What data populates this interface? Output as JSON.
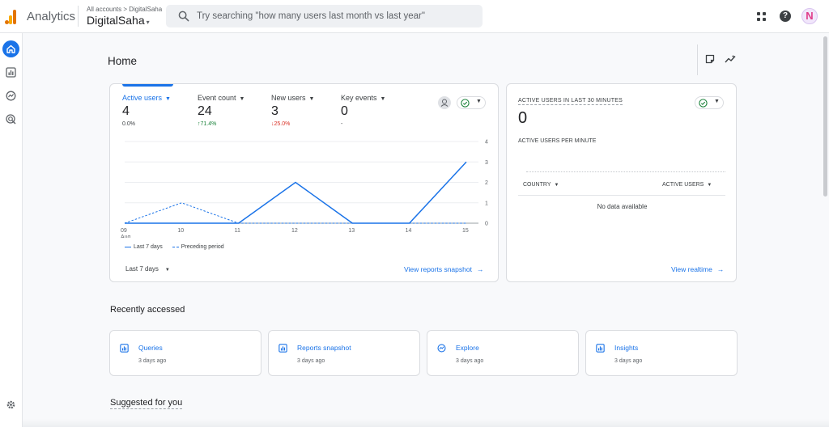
{
  "header": {
    "app_name": "Analytics",
    "breadcrumb": "All accounts > DigitalSaha",
    "account_name": "DigitalSaha",
    "search_placeholder": "Try searching \"how many users last month vs last year\"",
    "avatar_letter": "N",
    "icons": [
      "analytics-logo",
      "search-icon",
      "apps-grid-icon",
      "help-icon",
      "avatar"
    ]
  },
  "leftnav": {
    "items": [
      {
        "name": "home",
        "icon": "home-icon",
        "active": true
      },
      {
        "name": "reports",
        "icon": "bar-chart-icon"
      },
      {
        "name": "explore",
        "icon": "explore-icon"
      },
      {
        "name": "advertising",
        "icon": "target-icon"
      }
    ],
    "settings_icon": "gear-icon"
  },
  "page": {
    "title": "Home"
  },
  "metrics": [
    {
      "label": "Active users",
      "value": "4",
      "change": "0.0%",
      "trend": "neutral",
      "active": true
    },
    {
      "label": "Event count",
      "value": "24",
      "change": "↑71.4%",
      "trend": "up"
    },
    {
      "label": "New users",
      "value": "3",
      "change": "↓25.0%",
      "trend": "down"
    },
    {
      "label": "Key events",
      "value": "0",
      "change": "-",
      "trend": "neutral"
    }
  ],
  "chart_data": {
    "type": "line",
    "categories": [
      "09 Aug",
      "10",
      "11",
      "12",
      "13",
      "14",
      "15"
    ],
    "x_tick_labels": [
      [
        "09",
        "Aug"
      ],
      [
        "10"
      ],
      [
        "11"
      ],
      [
        "12"
      ],
      [
        "13"
      ],
      [
        "14"
      ],
      [
        "15"
      ]
    ],
    "series": [
      {
        "name": "Last 7 days",
        "style": "solid",
        "values": [
          0,
          0,
          0,
          2,
          0,
          0,
          3
        ]
      },
      {
        "name": "Preceding period",
        "style": "dashed",
        "values": [
          0,
          1,
          0,
          0,
          0,
          0,
          0
        ]
      }
    ],
    "ylim": [
      0,
      4
    ],
    "y_ticks": [
      0,
      1,
      2,
      3,
      4
    ],
    "y_axis_side": "right",
    "grid": true,
    "legend": "bottom-left",
    "color": "#1a73e8"
  },
  "metrics_card": {
    "range_label": "Last 7 days",
    "link_label": "View reports snapshot",
    "link_arrow": "→"
  },
  "realtime": {
    "title": "ACTIVE USERS IN LAST 30 MINUTES",
    "value": "0",
    "subtitle": "ACTIVE USERS PER MINUTE",
    "col_country": "COUNTRY",
    "col_active_users": "ACTIVE USERS",
    "empty_text": "No data available",
    "link_label": "View realtime",
    "link_arrow": "→"
  },
  "recently_accessed": {
    "title": "Recently accessed",
    "items": [
      {
        "title": "Queries",
        "time": "3 days ago",
        "icon": "bar-chart-icon"
      },
      {
        "title": "Reports snapshot",
        "time": "3 days ago",
        "icon": "bar-chart-icon"
      },
      {
        "title": "Explore",
        "time": "3 days ago",
        "icon": "explore-icon"
      },
      {
        "title": "Insights",
        "time": "3 days ago",
        "icon": "bar-chart-icon"
      }
    ]
  },
  "suggested": {
    "title": "Suggested for you"
  },
  "colors": {
    "accent": "#1a73e8",
    "positive": "#188038",
    "negative": "#d93025",
    "background": "#f8f9fb"
  }
}
